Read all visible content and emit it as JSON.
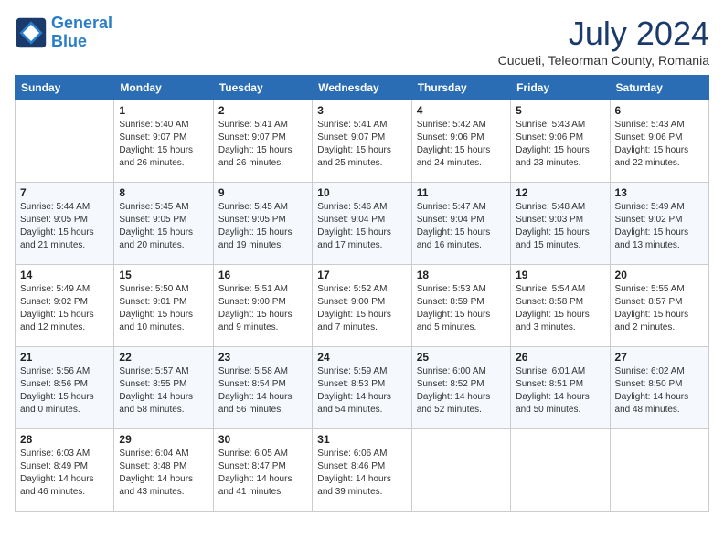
{
  "header": {
    "logo_line1": "General",
    "logo_line2": "Blue",
    "month_year": "July 2024",
    "location": "Cucueti, Teleorman County, Romania"
  },
  "days_of_week": [
    "Sunday",
    "Monday",
    "Tuesday",
    "Wednesday",
    "Thursday",
    "Friday",
    "Saturday"
  ],
  "weeks": [
    [
      {
        "day": "",
        "info": ""
      },
      {
        "day": "1",
        "info": "Sunrise: 5:40 AM\nSunset: 9:07 PM\nDaylight: 15 hours\nand 26 minutes."
      },
      {
        "day": "2",
        "info": "Sunrise: 5:41 AM\nSunset: 9:07 PM\nDaylight: 15 hours\nand 26 minutes."
      },
      {
        "day": "3",
        "info": "Sunrise: 5:41 AM\nSunset: 9:07 PM\nDaylight: 15 hours\nand 25 minutes."
      },
      {
        "day": "4",
        "info": "Sunrise: 5:42 AM\nSunset: 9:06 PM\nDaylight: 15 hours\nand 24 minutes."
      },
      {
        "day": "5",
        "info": "Sunrise: 5:43 AM\nSunset: 9:06 PM\nDaylight: 15 hours\nand 23 minutes."
      },
      {
        "day": "6",
        "info": "Sunrise: 5:43 AM\nSunset: 9:06 PM\nDaylight: 15 hours\nand 22 minutes."
      }
    ],
    [
      {
        "day": "7",
        "info": "Sunrise: 5:44 AM\nSunset: 9:05 PM\nDaylight: 15 hours\nand 21 minutes."
      },
      {
        "day": "8",
        "info": "Sunrise: 5:45 AM\nSunset: 9:05 PM\nDaylight: 15 hours\nand 20 minutes."
      },
      {
        "day": "9",
        "info": "Sunrise: 5:45 AM\nSunset: 9:05 PM\nDaylight: 15 hours\nand 19 minutes."
      },
      {
        "day": "10",
        "info": "Sunrise: 5:46 AM\nSunset: 9:04 PM\nDaylight: 15 hours\nand 17 minutes."
      },
      {
        "day": "11",
        "info": "Sunrise: 5:47 AM\nSunset: 9:04 PM\nDaylight: 15 hours\nand 16 minutes."
      },
      {
        "day": "12",
        "info": "Sunrise: 5:48 AM\nSunset: 9:03 PM\nDaylight: 15 hours\nand 15 minutes."
      },
      {
        "day": "13",
        "info": "Sunrise: 5:49 AM\nSunset: 9:02 PM\nDaylight: 15 hours\nand 13 minutes."
      }
    ],
    [
      {
        "day": "14",
        "info": "Sunrise: 5:49 AM\nSunset: 9:02 PM\nDaylight: 15 hours\nand 12 minutes."
      },
      {
        "day": "15",
        "info": "Sunrise: 5:50 AM\nSunset: 9:01 PM\nDaylight: 15 hours\nand 10 minutes."
      },
      {
        "day": "16",
        "info": "Sunrise: 5:51 AM\nSunset: 9:00 PM\nDaylight: 15 hours\nand 9 minutes."
      },
      {
        "day": "17",
        "info": "Sunrise: 5:52 AM\nSunset: 9:00 PM\nDaylight: 15 hours\nand 7 minutes."
      },
      {
        "day": "18",
        "info": "Sunrise: 5:53 AM\nSunset: 8:59 PM\nDaylight: 15 hours\nand 5 minutes."
      },
      {
        "day": "19",
        "info": "Sunrise: 5:54 AM\nSunset: 8:58 PM\nDaylight: 15 hours\nand 3 minutes."
      },
      {
        "day": "20",
        "info": "Sunrise: 5:55 AM\nSunset: 8:57 PM\nDaylight: 15 hours\nand 2 minutes."
      }
    ],
    [
      {
        "day": "21",
        "info": "Sunrise: 5:56 AM\nSunset: 8:56 PM\nDaylight: 15 hours\nand 0 minutes."
      },
      {
        "day": "22",
        "info": "Sunrise: 5:57 AM\nSunset: 8:55 PM\nDaylight: 14 hours\nand 58 minutes."
      },
      {
        "day": "23",
        "info": "Sunrise: 5:58 AM\nSunset: 8:54 PM\nDaylight: 14 hours\nand 56 minutes."
      },
      {
        "day": "24",
        "info": "Sunrise: 5:59 AM\nSunset: 8:53 PM\nDaylight: 14 hours\nand 54 minutes."
      },
      {
        "day": "25",
        "info": "Sunrise: 6:00 AM\nSunset: 8:52 PM\nDaylight: 14 hours\nand 52 minutes."
      },
      {
        "day": "26",
        "info": "Sunrise: 6:01 AM\nSunset: 8:51 PM\nDaylight: 14 hours\nand 50 minutes."
      },
      {
        "day": "27",
        "info": "Sunrise: 6:02 AM\nSunset: 8:50 PM\nDaylight: 14 hours\nand 48 minutes."
      }
    ],
    [
      {
        "day": "28",
        "info": "Sunrise: 6:03 AM\nSunset: 8:49 PM\nDaylight: 14 hours\nand 46 minutes."
      },
      {
        "day": "29",
        "info": "Sunrise: 6:04 AM\nSunset: 8:48 PM\nDaylight: 14 hours\nand 43 minutes."
      },
      {
        "day": "30",
        "info": "Sunrise: 6:05 AM\nSunset: 8:47 PM\nDaylight: 14 hours\nand 41 minutes."
      },
      {
        "day": "31",
        "info": "Sunrise: 6:06 AM\nSunset: 8:46 PM\nDaylight: 14 hours\nand 39 minutes."
      },
      {
        "day": "",
        "info": ""
      },
      {
        "day": "",
        "info": ""
      },
      {
        "day": "",
        "info": ""
      }
    ]
  ]
}
